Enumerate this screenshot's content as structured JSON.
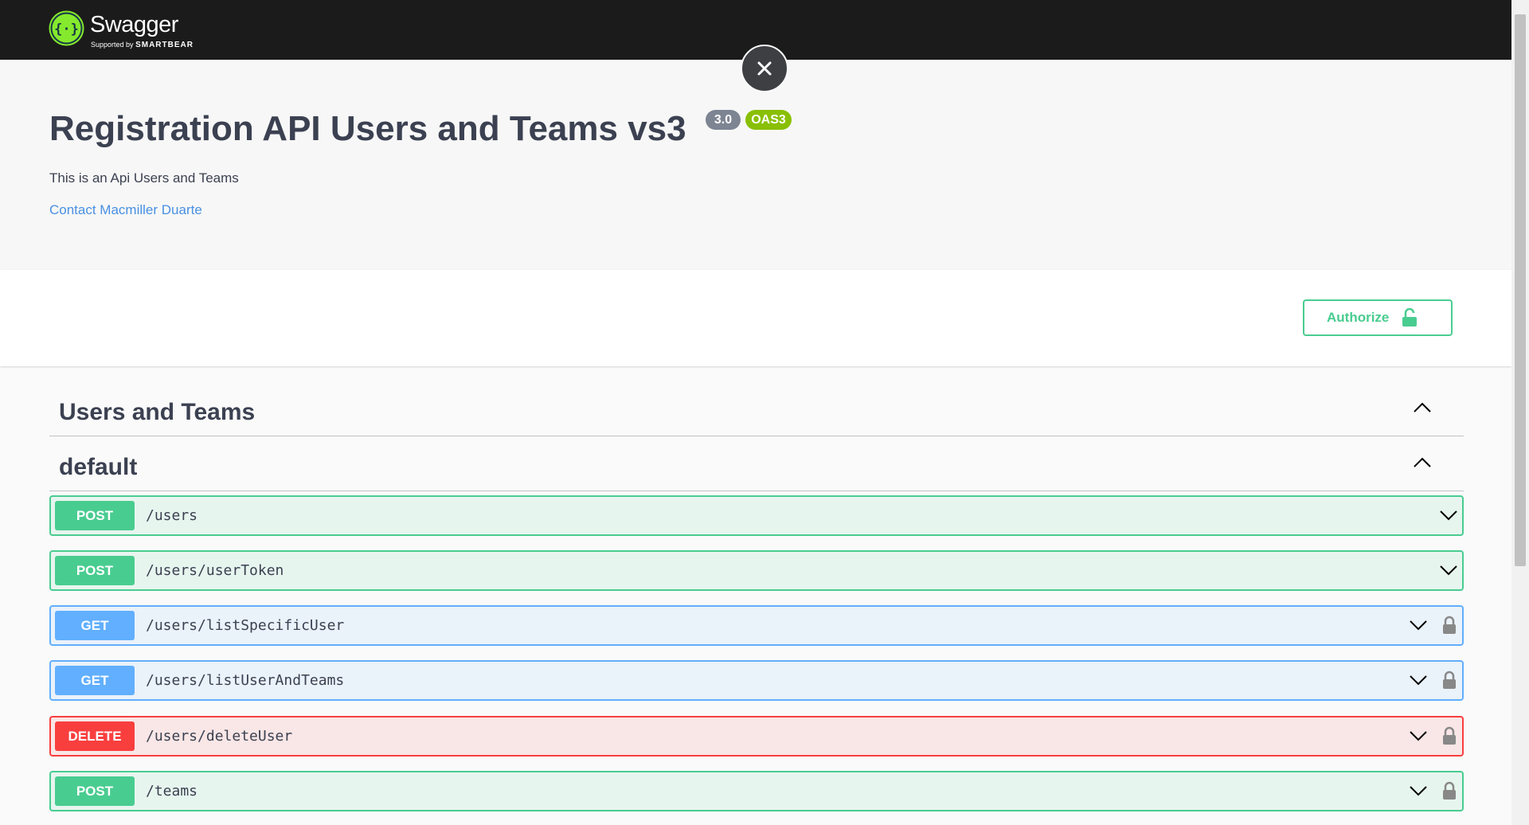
{
  "topbar": {
    "brand": "Swagger",
    "brand_sub_prefix": "Supported by",
    "brand_sub_name": "SMARTBEAR"
  },
  "info": {
    "title": "Registration API Users and Teams vs3",
    "version_badge": "3.0",
    "oas_badge": "OAS3",
    "description": "This is an Api Users and Teams",
    "contact_link": "Contact Macmiller Duarte"
  },
  "scheme": {
    "authorize_label": "Authorize"
  },
  "tags": [
    {
      "name": "Users and Teams",
      "expanded": true
    },
    {
      "name": "default",
      "expanded": true
    }
  ],
  "operations": [
    {
      "method": "POST",
      "path": "/users",
      "locked": false
    },
    {
      "method": "POST",
      "path": "/users/userToken",
      "locked": false
    },
    {
      "method": "GET",
      "path": "/users/listSpecificUser",
      "locked": true
    },
    {
      "method": "GET",
      "path": "/users/listUserAndTeams",
      "locked": true
    },
    {
      "method": "DELETE",
      "path": "/users/deleteUser",
      "locked": true
    },
    {
      "method": "POST",
      "path": "/teams",
      "locked": true
    }
  ],
  "colors": {
    "post": "#49cc90",
    "get": "#61affe",
    "delete": "#f93e3e",
    "link": "#4990e2",
    "topbar": "#1b1b1b"
  },
  "icons": {
    "logo": "swagger-logo-icon",
    "close": "close-icon",
    "authorize_lock": "unlocked-padlock-icon",
    "collapse": "chevron-up-icon",
    "expand": "chevron-down-icon",
    "op_lock": "locked-padlock-icon"
  }
}
